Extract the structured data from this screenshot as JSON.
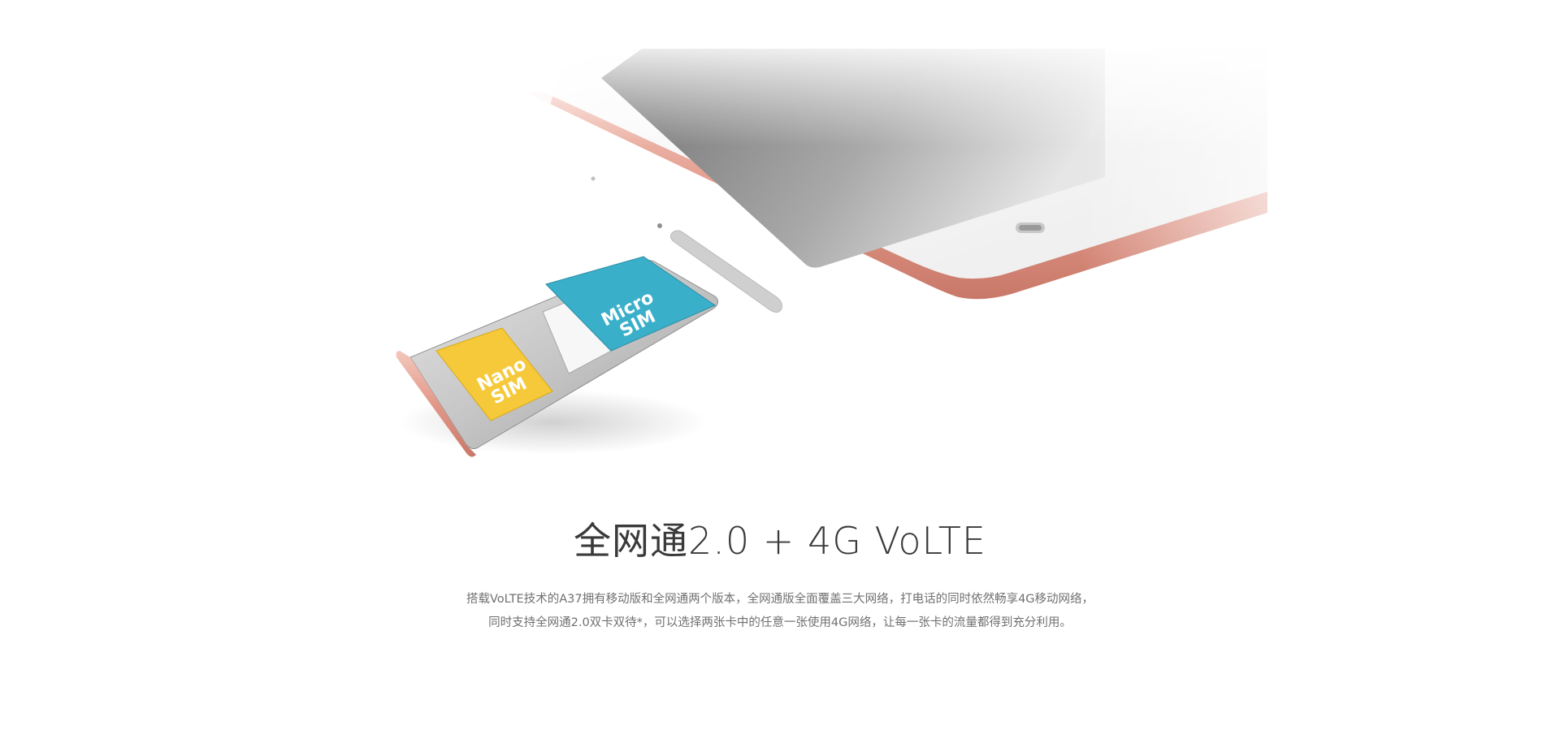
{
  "feature": {
    "title": "全网通2.0 + 4G VoLTE",
    "description_lines": [
      "搭载VoLTE技术的A37拥有移动版和全网通两个版本，全网通版全面覆盖三大网络，打电话的同时依然畅享4G移动网络，",
      "同时支持全网通2.0双卡双待*，可以选择两张卡中的任意一张使用4G网络，让每一张卡的流量都得到充分利用。"
    ]
  },
  "sim_tray": {
    "nano_label_line1": "Nano",
    "nano_label_line2": "SIM",
    "micro_label_line1": "Micro",
    "micro_label_line2": "SIM",
    "nano_color": "#f5c93a",
    "micro_color": "#3aafc9"
  },
  "phone": {
    "frame_color": "#e8a89a"
  }
}
